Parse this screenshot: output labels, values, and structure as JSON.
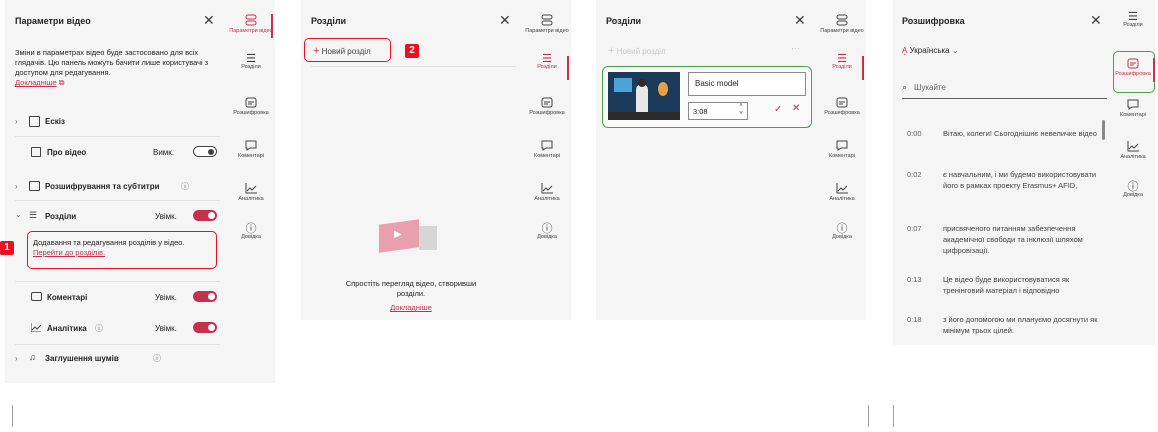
{
  "colors": {
    "accent": "#c4314b",
    "badge": "#e81123",
    "highlight_green": "#4aa34a",
    "panel_bg": "#f5f5f5"
  },
  "rail": {
    "video_settings": "Параметри відео",
    "chapters": "Розділи",
    "transcript": "Розшифровка",
    "comments": "Коментарі",
    "analytics": "Аналітика",
    "help": "Довідка"
  },
  "panel1": {
    "title": "Параметри відео",
    "description": "Зміни в параметрах відео буде застосовано для всіх глядачів. Цю панель можуть бачити лише користувачі з доступом для редагування.",
    "learn_more": "Докладніше",
    "sketch": "Ескіз",
    "about_video": "Про відео",
    "about_state": "Вимк.",
    "subtitles": "Розшифрування та субтитри",
    "chapters": "Розділи",
    "chapters_state": "Увімк.",
    "chapters_desc": "Додавання та редагування розділів у відео.",
    "go_to_chapters": "Перейти до розділів.",
    "comments": "Коментарі",
    "comments_state": "Увімк.",
    "analytics": "Аналітика",
    "analytics_state": "Увімк.",
    "noise": "Заглушення шумів",
    "badge": "1"
  },
  "panel2": {
    "title": "Розділи",
    "new_chapter": "Новий розділ",
    "badge": "2",
    "empty_text": "Спростіть перегляд відео, створивши розділи.",
    "learn_more": "Докладніше"
  },
  "panel3": {
    "title": "Розділи",
    "new_chapter": "Новий розділ",
    "chapter_name": "Basic model",
    "chapter_time": "3:08"
  },
  "panel4": {
    "title": "Розшифровка",
    "language": "Українська",
    "search_placeholder": "Шукайте",
    "entries": [
      {
        "time": "0:00",
        "text": "Вітаю, колеги!  Сьогоднішнє невеличке відео"
      },
      {
        "time": "0:02",
        "text": "є навчальним, і ми будемо використовувати  його в рамках проекту Erasmus+ AFID,"
      },
      {
        "time": "0:07",
        "text": "присвяченого питанням забезпечення  академічної свободи та інклюзії шляхом цифровізації."
      },
      {
        "time": "0:13",
        "text": "Це відео буде використовуватися як тренінговий матеріал і відповідно"
      },
      {
        "time": "0:18",
        "text": "з його допомогою ми плануємо досягнути як мінімум трьох цілей."
      }
    ]
  }
}
